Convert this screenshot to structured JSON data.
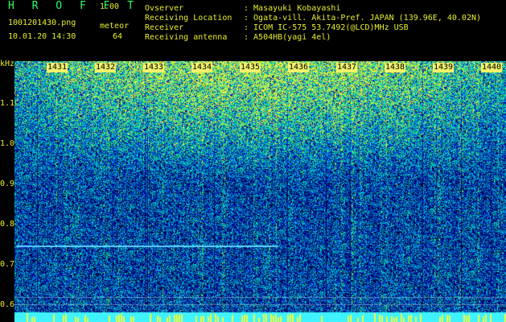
{
  "app": {
    "title": "H R O F F T",
    "version": "1.00",
    "filename": "1001201430.png",
    "datetime": "10.01.20 14:30",
    "counter_label": "meteor",
    "counter_value": "64"
  },
  "info": [
    {
      "key": "Ovserver",
      "value": ": Masayuki Kobayashi"
    },
    {
      "key": "Receiving Location",
      "value": ": Ogata-vill. Akita-Pref. JAPAN (139.96E, 40.02N)"
    },
    {
      "key": "Receiver",
      "value": ": ICOM IC-575 53.7492(@LCD)MHz USB"
    },
    {
      "key": "Receiving antenna",
      "value": ": A504HB(yagi 4el)"
    }
  ],
  "axis": {
    "unit": "kHz",
    "y_labels": [
      "1.1",
      "1.0",
      "0.9",
      "0.8",
      "0.7",
      "0.6"
    ],
    "x_ticks": [
      "1431",
      "1432",
      "1433",
      "1434",
      "1435",
      "1436",
      "1437",
      "1438",
      "1439",
      "1440"
    ]
  },
  "colors": {
    "background": "#000000",
    "label_yellow": "#e8ef2a",
    "title_green": "#2dff6a",
    "tick_bg": "#f2f26a"
  }
}
